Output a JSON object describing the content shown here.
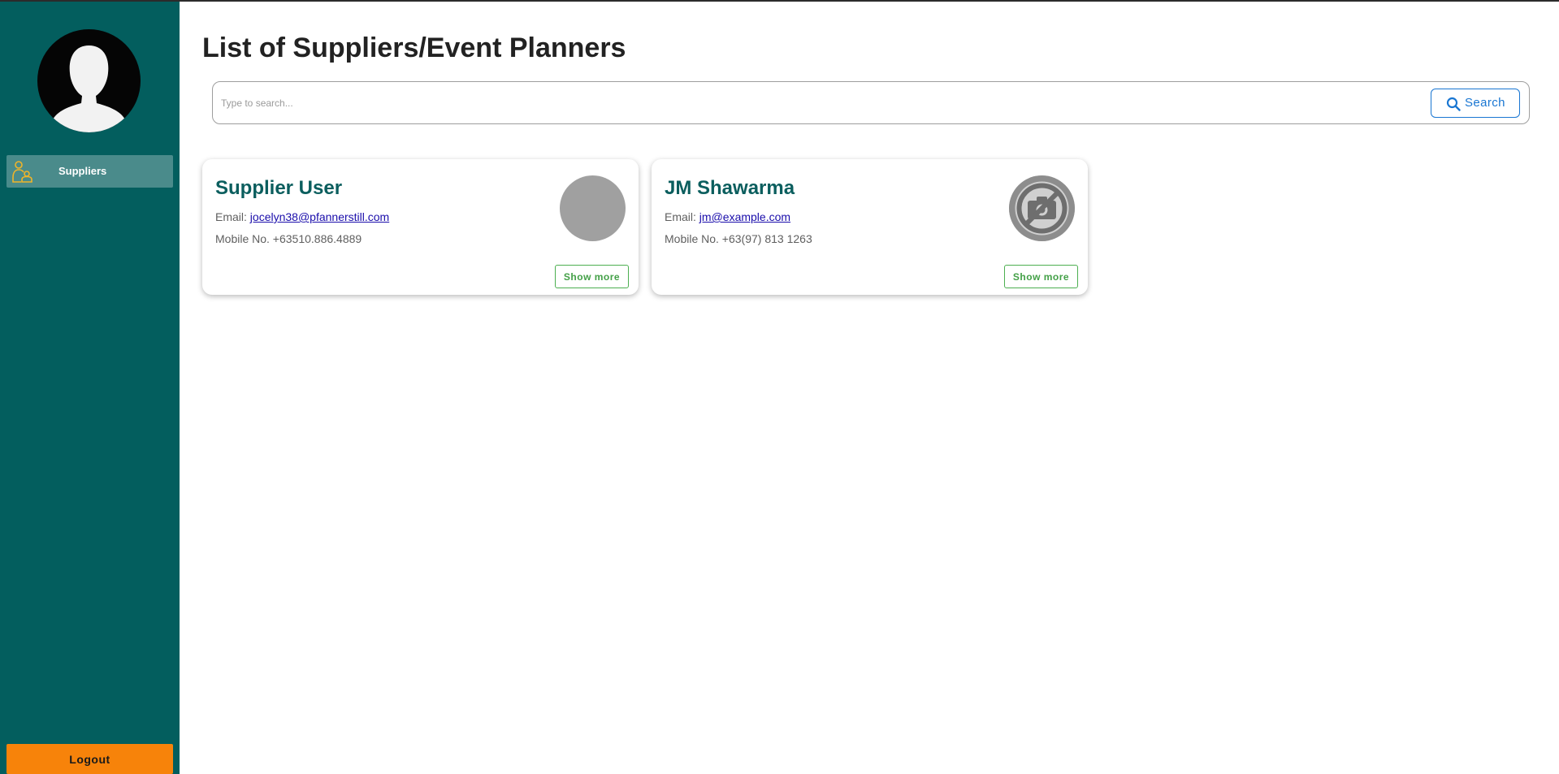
{
  "sidebar": {
    "nav": [
      {
        "label": "Suppliers",
        "icon": "suppliers-icon"
      }
    ],
    "logout_label": "Logout"
  },
  "main": {
    "title": "List of Suppliers/Event Planners",
    "search": {
      "placeholder": "Type to search...",
      "value": "",
      "button_label": "Search"
    },
    "cards": [
      {
        "name": "Supplier User",
        "email_label": "Email:",
        "email": "jocelyn38@pfannerstill.com",
        "mobile": "Mobile No. +63510.886.4889",
        "photo": "gray-circle-placeholder",
        "show_more_label": "Show more"
      },
      {
        "name": "JM Shawarma",
        "email_label": "Email:",
        "email": "jm@example.com",
        "mobile": "Mobile No. +63(97) 813 1263",
        "photo": "no-photo-icon",
        "show_more_label": "Show more"
      }
    ]
  },
  "colors": {
    "sidebar_bg": "#035e5e",
    "nav_active_bg": "#4a8b8b",
    "nav_icon": "#f0b429",
    "logout_bg": "#f7830a",
    "card_title": "#0b5e5e",
    "search_accent": "#1976d2",
    "show_more_accent": "#43a047"
  }
}
